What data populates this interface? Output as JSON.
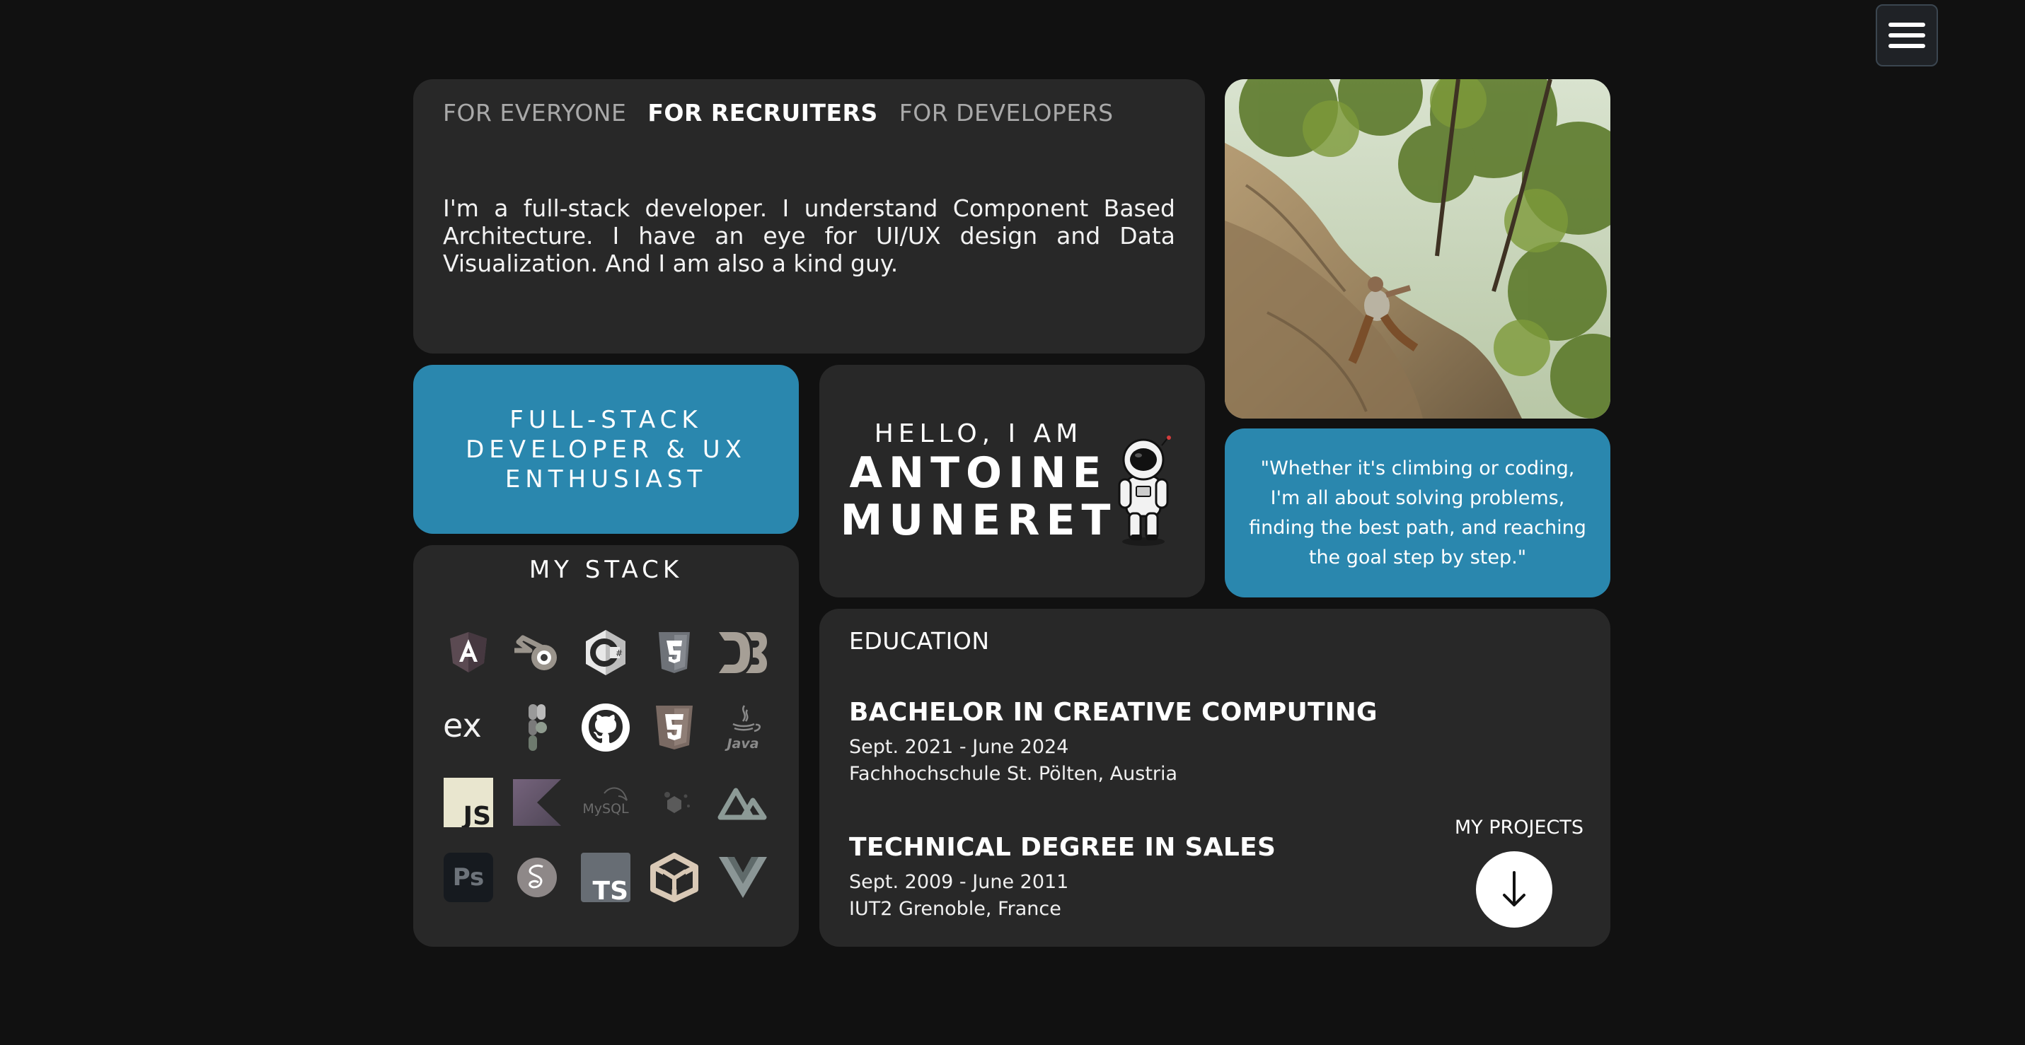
{
  "menu": {
    "icon": "hamburger-menu-icon"
  },
  "about": {
    "tabs": [
      "FOR EVERYONE",
      "FOR RECRUITERS",
      "FOR DEVELOPERS"
    ],
    "active_tab": "FOR RECRUITERS",
    "text": "I'm a full-stack developer. I understand Component Based Architecture. I have an eye for UI/UX design and Data Visualization. And I am also a kind guy."
  },
  "role": {
    "line1": "FULL-STACK",
    "line2": "DEVELOPER & UX",
    "line3": "ENTHUSIAST"
  },
  "hello": {
    "small": "HELLO, I AM",
    "first": "ANTOINE",
    "last": "MUNERET"
  },
  "quote": {
    "text": "\"Whether it's climbing or coding, I'm all about solving problems, finding the best path, and reaching the goal step by step.\""
  },
  "stack": {
    "title": "MY STACK",
    "labels": {
      "express": "ex",
      "mysql": "MySQL",
      "java": "Java",
      "js": "JS",
      "ps": "Ps",
      "ts": "TS"
    },
    "icons": [
      "angular-icon",
      "blender-icon",
      "csharp-icon",
      "css3-icon",
      "d3-icon",
      "express-icon",
      "figma-icon",
      "github-icon",
      "html5-icon",
      "java-icon",
      "javascript-icon",
      "kotlin-icon",
      "mysql-icon",
      "nodejs-icon",
      "nuxt-icon",
      "photoshop-icon",
      "sass-icon",
      "typescript-icon",
      "unity-icon",
      "vue-icon"
    ]
  },
  "education": {
    "title": "EDUCATION",
    "degrees": [
      {
        "name": "BACHELOR IN CREATIVE COMPUTING",
        "dates": "Sept. 2021 - June 2024",
        "school": "Fachhochschule St. Pölten, Austria"
      },
      {
        "name": "TECHNICAL DEGREE IN SALES",
        "dates": "Sept. 2009 - June 2011",
        "school": "IUT2 Grenoble, France"
      }
    ]
  },
  "projects": {
    "label": "MY PROJECTS",
    "icon": "arrow-down-icon"
  },
  "colors": {
    "background": "#111111",
    "card": "#282828",
    "accent": "#2a87ae"
  }
}
